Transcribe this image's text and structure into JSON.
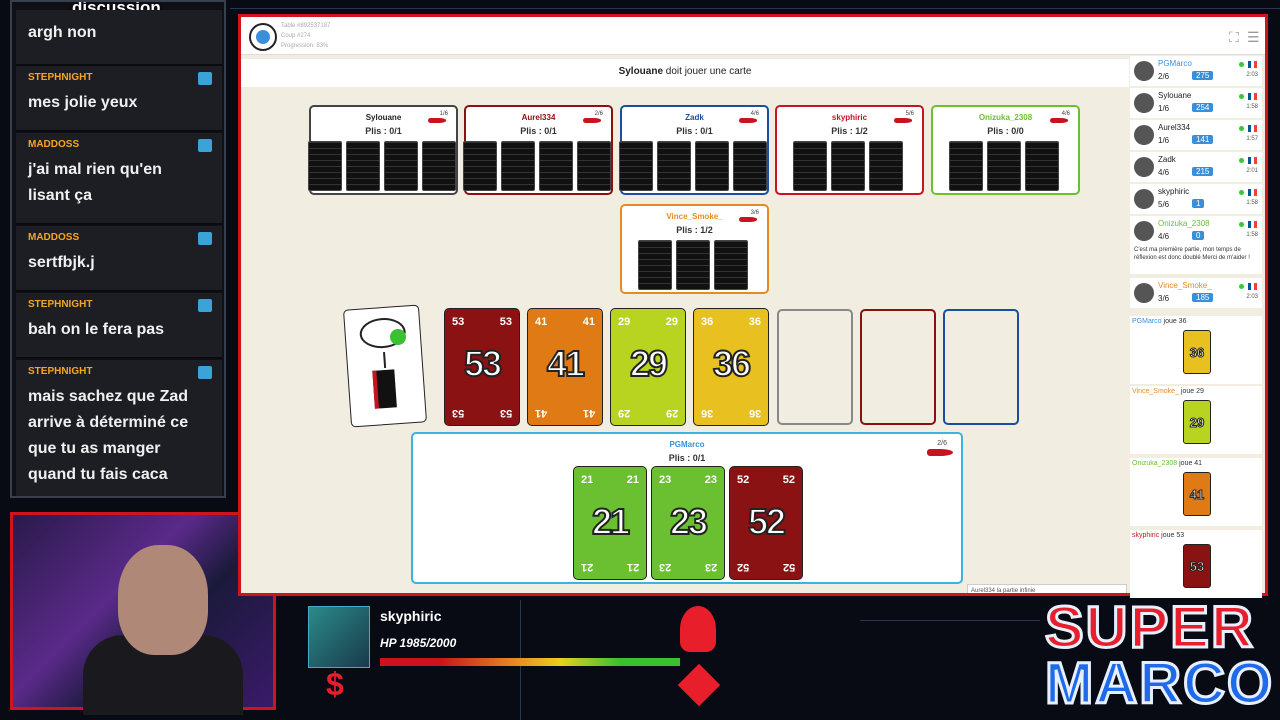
{
  "chat": {
    "title": "discussion",
    "messages": [
      {
        "author": "",
        "text": "argh non"
      },
      {
        "author": "STEPHNIGHT",
        "text": "mes jolie yeux"
      },
      {
        "author": "MADDOSS",
        "text": "j'ai mal rien qu'en lisant ça"
      },
      {
        "author": "MADDOSS",
        "text": "sertfbjk.j"
      },
      {
        "author": "STEPHNIGHT",
        "text": "bah on le fera pas"
      },
      {
        "author": "STEPHNIGHT",
        "text": "mais sachez que Zad arrive à déterminé ce que tu as manger quand tu fais caca"
      }
    ]
  },
  "game": {
    "table": "Table #892537187",
    "coup": "Coup #274",
    "progress": "Progression: 83%",
    "status_player": "Sylouane",
    "status_text": " doit jouer une carte",
    "opponents": [
      {
        "name": "Sylouane",
        "plis": "Plis : 0/1",
        "count": "1/6",
        "color": "#444",
        "cards": 4
      },
      {
        "name": "Aurel334",
        "plis": "Plis : 0/1",
        "count": "2/6",
        "color": "#8b1010",
        "cards": 4
      },
      {
        "name": "Zadk",
        "plis": "Plis : 0/1",
        "count": "4/6",
        "color": "#1a4fa0",
        "cards": 4
      },
      {
        "name": "skyphiric",
        "plis": "Plis : 1/2",
        "count": "5/6",
        "color": "#c8141e",
        "cards": 3
      },
      {
        "name": "Onizuka_2308",
        "plis": "Plis : 0/0",
        "count": "4/6",
        "color": "#6ac030",
        "cards": 3
      },
      {
        "name": "Vince_Smoke_",
        "plis": "Plis : 1/2",
        "count": "3/6",
        "color": "#e88a20",
        "cards": 3
      }
    ],
    "row_cards": [
      {
        "v": "53",
        "c": "#8a1212"
      },
      {
        "v": "41",
        "c": "#e07a14"
      },
      {
        "v": "29",
        "c": "#b8d420"
      },
      {
        "v": "36",
        "c": "#e8c020"
      }
    ],
    "me": {
      "name": "PGMarco",
      "plis": "Plis : 0/1",
      "count": "2/6",
      "cards": [
        {
          "v": "21",
          "c": "#6ac030"
        },
        {
          "v": "23",
          "c": "#6ac030"
        },
        {
          "v": "52",
          "c": "#8a1212"
        }
      ]
    },
    "footer": "Aurel334 la partie infinie"
  },
  "players": [
    {
      "name": "PGMarco",
      "score": "2/6",
      "badge": "275",
      "time": "2:03",
      "c": "#3a8fd8"
    },
    {
      "name": "Sylouane",
      "score": "1/6",
      "badge": "254",
      "time": "1:58",
      "c": "#222"
    },
    {
      "name": "Aurel334",
      "score": "1/6",
      "badge": "141",
      "time": "1:57",
      "c": "#222"
    },
    {
      "name": "Zadk",
      "score": "4/6",
      "badge": "215",
      "time": "2:01",
      "c": "#222"
    },
    {
      "name": "skyphiric",
      "score": "5/6",
      "badge": "1",
      "time": "1:58",
      "c": "#222"
    },
    {
      "name": "Onizuka_2308",
      "score": "4/6",
      "badge": "0",
      "time": "1:58",
      "c": "#6ac030"
    },
    {
      "name": "Vince_Smoke_",
      "score": "3/6",
      "badge": "185",
      "time": "2:03",
      "c": "#e88a20"
    }
  ],
  "player_msg": "C'est ma première partie, mon temps de réflexion est donc doublé Merci de m'aider !",
  "log": [
    {
      "who": "PGMarco",
      "act": " joue 36",
      "v": "36",
      "c": "#e8c020",
      "wc": "#3a8fd8"
    },
    {
      "who": "Vince_Smoke_",
      "act": " joue 29",
      "v": "29",
      "c": "#b8d420",
      "wc": "#e88a20"
    },
    {
      "who": "Onizuka_2308",
      "act": " joue 41",
      "v": "41",
      "c": "#e07a14",
      "wc": "#6ac030"
    },
    {
      "who": "skyphiric",
      "act": " joue 53",
      "v": "53",
      "c": "#8a1212",
      "wc": "#c8141e"
    }
  ],
  "overlay": {
    "name": "skyphiric",
    "hp": "HP 1985/2000",
    "logo1": "SUPER",
    "logo2": "MARCO"
  }
}
